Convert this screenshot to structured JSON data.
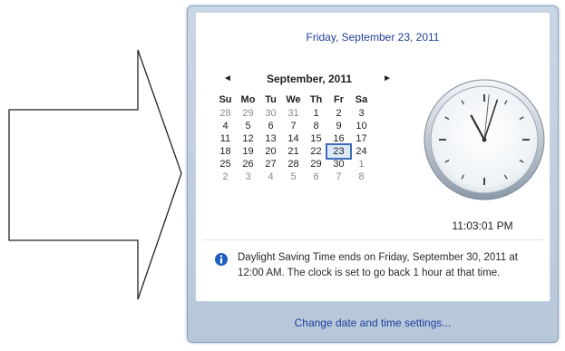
{
  "header": {
    "full_date": "Friday, September 23, 2011"
  },
  "calendar": {
    "month_title": "September, 2011",
    "prev_symbol": "◄",
    "next_symbol": "►",
    "weekdays": [
      "Su",
      "Mo",
      "Tu",
      "We",
      "Th",
      "Fr",
      "Sa"
    ],
    "weeks": [
      [
        {
          "d": "28",
          "other": true
        },
        {
          "d": "29",
          "other": true
        },
        {
          "d": "30",
          "other": true
        },
        {
          "d": "31",
          "other": true
        },
        {
          "d": "1"
        },
        {
          "d": "2"
        },
        {
          "d": "3"
        }
      ],
      [
        {
          "d": "4"
        },
        {
          "d": "5"
        },
        {
          "d": "6"
        },
        {
          "d": "7"
        },
        {
          "d": "8"
        },
        {
          "d": "9"
        },
        {
          "d": "10"
        }
      ],
      [
        {
          "d": "11"
        },
        {
          "d": "12"
        },
        {
          "d": "13"
        },
        {
          "d": "14"
        },
        {
          "d": "15"
        },
        {
          "d": "16"
        },
        {
          "d": "17"
        }
      ],
      [
        {
          "d": "18"
        },
        {
          "d": "19"
        },
        {
          "d": "20"
        },
        {
          "d": "21"
        },
        {
          "d": "22"
        },
        {
          "d": "23",
          "today": true
        },
        {
          "d": "24"
        }
      ],
      [
        {
          "d": "25"
        },
        {
          "d": "26"
        },
        {
          "d": "27"
        },
        {
          "d": "28"
        },
        {
          "d": "29"
        },
        {
          "d": "30"
        },
        {
          "d": "1",
          "other": true
        }
      ],
      [
        {
          "d": "2",
          "other": true
        },
        {
          "d": "3",
          "other": true
        },
        {
          "d": "4",
          "other": true
        },
        {
          "d": "5",
          "other": true
        },
        {
          "d": "6",
          "other": true
        },
        {
          "d": "7",
          "other": true
        },
        {
          "d": "8",
          "other": true
        }
      ]
    ]
  },
  "clock": {
    "time_text": "11:03:01 PM",
    "hour": 11,
    "minute": 3,
    "second": 1
  },
  "info": {
    "icon": "info-icon",
    "text": "Daylight Saving Time ends on Friday, September 30, 2011 at 12:00 AM. The clock is set to go back 1 hour at that time."
  },
  "footer": {
    "link_label": "Change date and time settings..."
  },
  "colors": {
    "link": "#1e3f9b",
    "today_outline": "#3d6db5",
    "info_icon": "#1f5fbf"
  }
}
